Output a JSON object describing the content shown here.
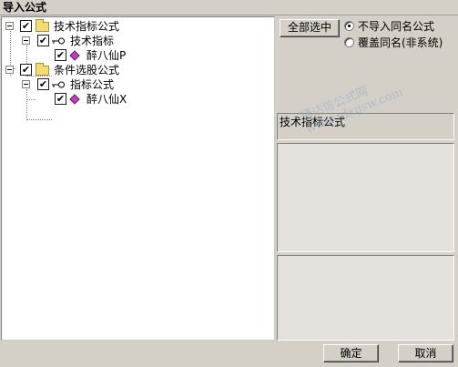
{
  "window": {
    "title": "导入公式"
  },
  "tree": {
    "nodes": [
      {
        "label": "技术指标公式",
        "type": "folder",
        "checked": true,
        "expanded": true
      },
      {
        "label": "技术指标",
        "type": "key",
        "checked": true,
        "expanded": true
      },
      {
        "label": "醉八仙P",
        "type": "formula",
        "checked": true
      },
      {
        "label": "条件选股公式",
        "type": "folder",
        "checked": true,
        "expanded": true
      },
      {
        "label": "指标公式",
        "type": "key",
        "checked": true,
        "expanded": true
      },
      {
        "label": "醉八仙X",
        "type": "formula",
        "checked": true
      }
    ]
  },
  "options": {
    "select_all_label": "全部选中",
    "radio_skip_label": "不导入同名公式",
    "radio_overwrite_label": "覆盖同名(非系统)",
    "selected_radio": "skip"
  },
  "info_panel": {
    "label": "技术指标公式"
  },
  "footer": {
    "ok_label": "确定",
    "cancel_label": "取消"
  },
  "watermark": {
    "line1": "通达信公式网",
    "line2": "www.tdxgsw.com"
  },
  "colors": {
    "dialog_bg": "#d4d0c8",
    "tree_bg": "#ffffff",
    "folder": "#f4dc74",
    "formula_icon": "#c040c0"
  }
}
